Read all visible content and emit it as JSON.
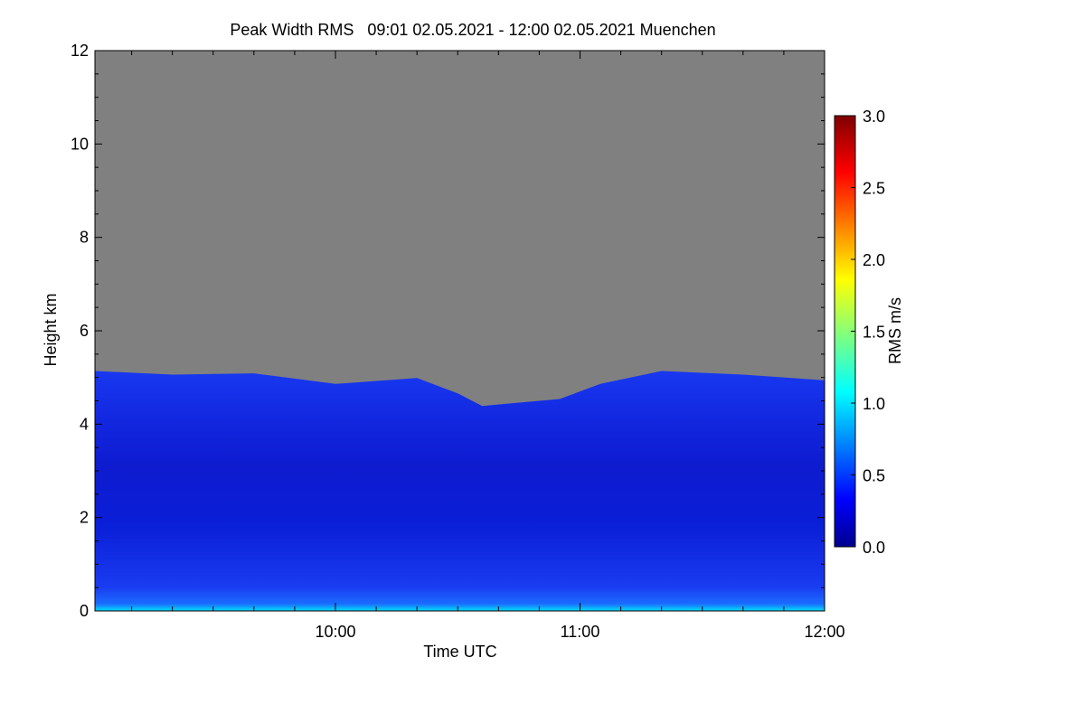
{
  "chart_data": {
    "type": "heatmap",
    "title": "Peak Width RMS   09:01 02.05.2021 - 12:00 02.05.2021 Muenchen",
    "xlabel": "Time UTC",
    "ylabel": "Height km",
    "xlim": [
      "09:01",
      "12:00"
    ],
    "ylim": [
      0,
      12
    ],
    "x_ticks": [
      "10:00",
      "11:00",
      "12:00"
    ],
    "y_ticks": [
      "0",
      "2",
      "4",
      "6",
      "8",
      "10",
      "12"
    ],
    "colorbar": {
      "label": "RMS m/s",
      "range": [
        0.0,
        3.0
      ],
      "ticks": [
        "0.0",
        "0.5",
        "1.0",
        "1.5",
        "2.0",
        "2.5",
        "3.0"
      ],
      "colormap": "jet"
    },
    "no_data_color": "#808080",
    "signal_top_km": {
      "times": [
        "09:01",
        "09:20",
        "09:40",
        "10:00",
        "10:20",
        "10:30",
        "10:36",
        "10:45",
        "10:55",
        "11:05",
        "11:20",
        "11:40",
        "12:00"
      ],
      "heights": [
        5.1,
        5.1,
        5.05,
        4.9,
        4.95,
        4.7,
        4.35,
        4.5,
        4.5,
        4.9,
        5.1,
        5.1,
        4.9
      ]
    },
    "rms_profile": {
      "heights_km": [
        0.0,
        0.2,
        0.5,
        1.0,
        1.5,
        2.0,
        3.0,
        4.0,
        4.5,
        5.0
      ],
      "values": [
        0.95,
        0.75,
        0.45,
        0.4,
        0.35,
        0.3,
        0.25,
        0.3,
        0.4,
        0.4
      ]
    }
  }
}
